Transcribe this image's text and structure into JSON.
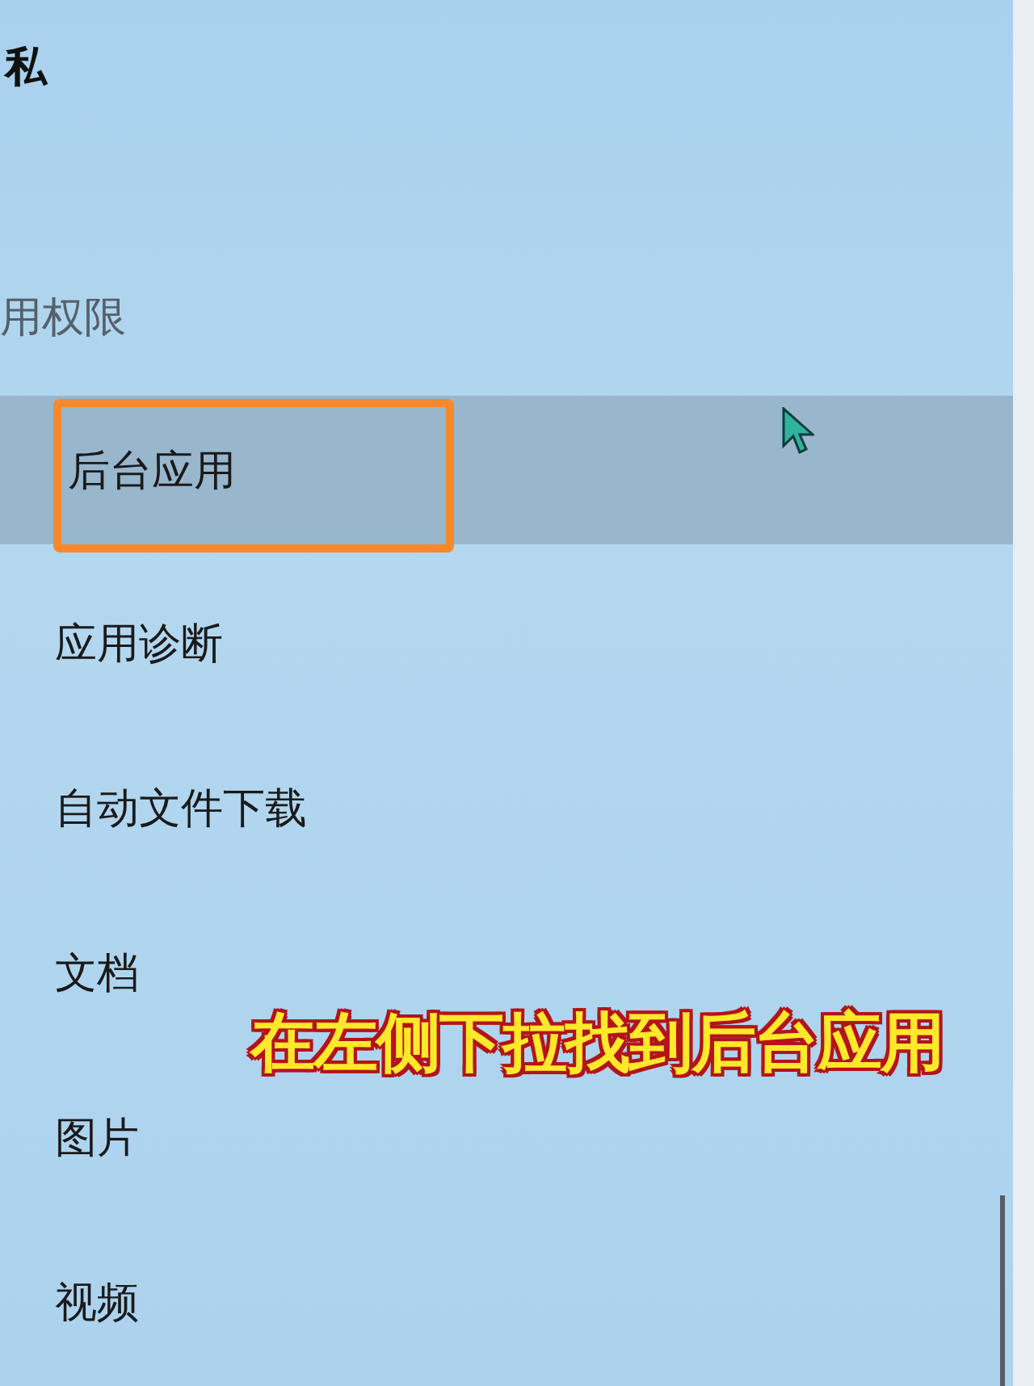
{
  "title": "私",
  "section": "用权限",
  "items": [
    {
      "label": "后台应用",
      "selected": true,
      "highlighted": true
    },
    {
      "label": "应用诊断",
      "selected": false,
      "highlighted": false
    },
    {
      "label": "自动文件下载",
      "selected": false,
      "highlighted": false
    },
    {
      "label": "文档",
      "selected": false,
      "highlighted": false
    },
    {
      "label": "图片",
      "selected": false,
      "highlighted": false
    },
    {
      "label": "视频",
      "selected": false,
      "highlighted": false
    }
  ],
  "caption": "在左侧下拉找到后台应用"
}
